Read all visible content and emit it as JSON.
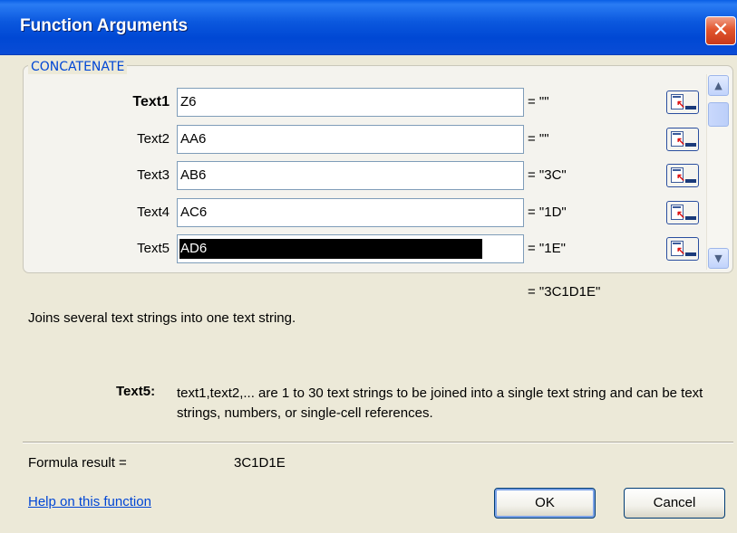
{
  "window": {
    "title": "Function Arguments",
    "close_symbol": "✕"
  },
  "function_name": "CONCATENATE",
  "arguments": [
    {
      "label": "Text1",
      "value": "Z6",
      "result": "= \"\"",
      "bold": true,
      "selected": false
    },
    {
      "label": "Text2",
      "value": "AA6",
      "result": "= \"\"",
      "bold": false,
      "selected": false
    },
    {
      "label": "Text3",
      "value": "AB6",
      "result": "= \"3C\"",
      "bold": false,
      "selected": false
    },
    {
      "label": "Text4",
      "value": "AC6",
      "result": "= \"1D\"",
      "bold": false,
      "selected": false
    },
    {
      "label": "Text5",
      "value": "AD6",
      "result": "= \"1E\"",
      "bold": false,
      "selected": true
    }
  ],
  "overall_result": "= \"3C1D1E\"",
  "description": "Joins several text strings into one text string.",
  "help": {
    "arg_name": "Text5:",
    "text": "text1,text2,... are 1 to 30 text strings to be joined into a single text string and can be text strings, numbers, or single-cell references."
  },
  "formula_result": {
    "label": "Formula result =",
    "value": "3C1D1E"
  },
  "help_link": "Help on this function",
  "buttons": {
    "ok": "OK",
    "cancel": "Cancel"
  },
  "scrollbar": {
    "up_symbol": "▲",
    "down_symbol": "▼"
  }
}
